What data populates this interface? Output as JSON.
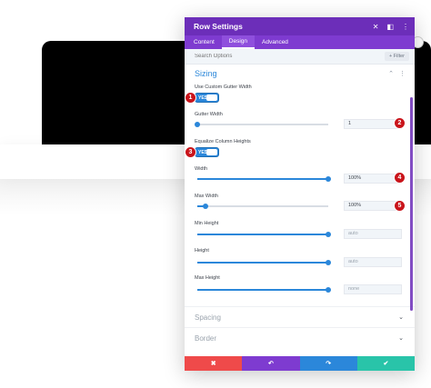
{
  "modal": {
    "title": "Row Settings",
    "tabs": [
      {
        "label": "Content",
        "active": false
      },
      {
        "label": "Design",
        "active": true
      },
      {
        "label": "Advanced",
        "active": false
      }
    ],
    "search_placeholder": "Search Options",
    "filter_label": "+ Filter",
    "section_title": "Sizing",
    "fields": {
      "custom_gutter_label": "Use Custom Gutter Width",
      "custom_gutter_value": "YES",
      "gutter_width_label": "Gutter Width",
      "gutter_width_value": "1",
      "equalize_label": "Equalize Column Heights",
      "equalize_value": "YES",
      "width_label": "Width",
      "width_value": "100%",
      "max_width_label": "Max Width",
      "max_width_value": "100%",
      "min_height_label": "Min Height",
      "min_height_value": "auto",
      "height_label": "Height",
      "height_value": "auto",
      "max_height_label": "Max Height",
      "max_height_value": "none"
    },
    "sliders": {
      "gutter_width": 0.0,
      "width": 1.0,
      "max_width": 0.06,
      "min_height": 1.0,
      "height": 1.0,
      "max_height": 1.0
    },
    "collapsed_sections": [
      "Spacing",
      "Border"
    ],
    "footer_icons": [
      "close-icon",
      "undo-icon",
      "redo-icon",
      "check-icon"
    ]
  },
  "badges": [
    "1",
    "2",
    "3",
    "4",
    "5"
  ],
  "colors": {
    "header": "#6c2eb9",
    "tabs": "#7e3bd0",
    "accent": "#2b87da",
    "badge": "#c9141b",
    "cancel": "#ef4a4a",
    "save": "#29c4a9"
  }
}
